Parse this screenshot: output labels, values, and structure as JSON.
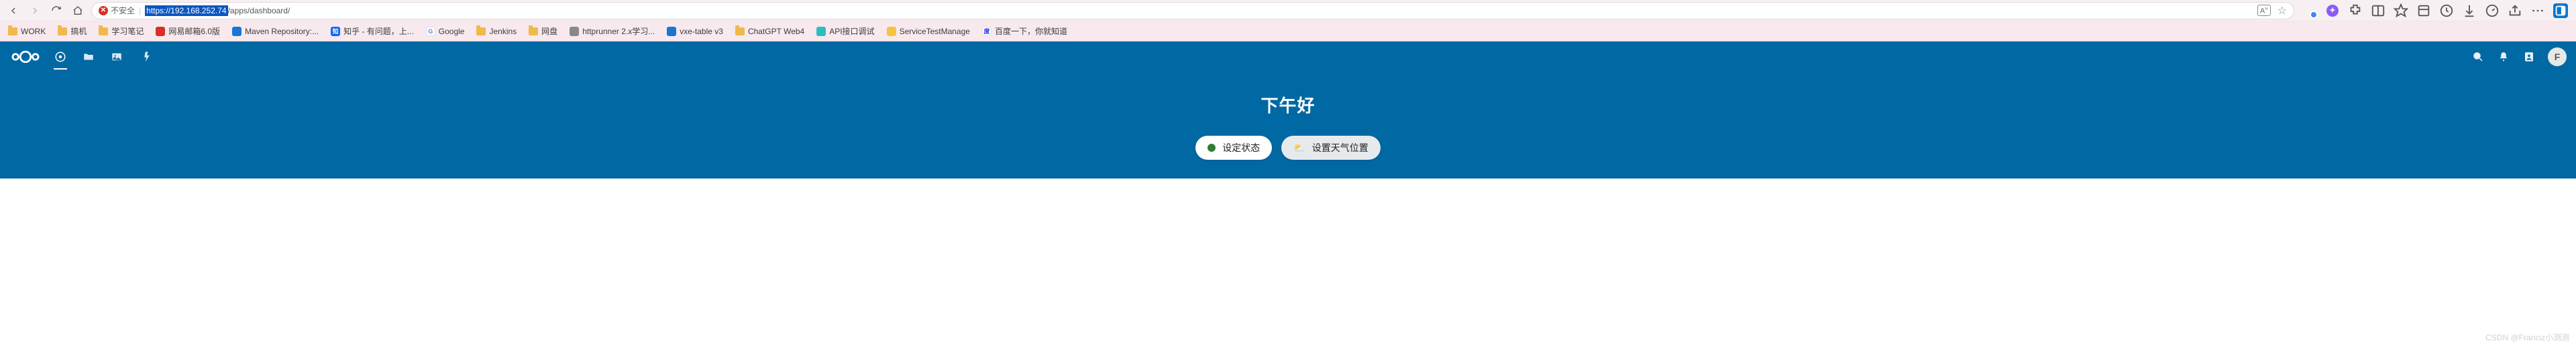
{
  "browser": {
    "insecure_label": "不安全",
    "url_selected": "https://192.168.252.74",
    "url_rest": "/apps/dashboard/",
    "reader": "A"
  },
  "bookmarks": [
    {
      "type": "folder",
      "label": "WORK"
    },
    {
      "type": "folder",
      "label": "搞机"
    },
    {
      "type": "folder",
      "label": "学习笔记"
    },
    {
      "type": "link",
      "icon": "red",
      "label": "网易邮箱6.0版"
    },
    {
      "type": "link",
      "icon": "blue",
      "label": "Maven Repository:..."
    },
    {
      "type": "link",
      "icon": "zh",
      "label": "知乎 - 有问题，上..."
    },
    {
      "type": "link",
      "icon": "google",
      "label": "Google"
    },
    {
      "type": "folder",
      "label": "Jenkins"
    },
    {
      "type": "folder",
      "label": "网盘"
    },
    {
      "type": "link",
      "icon": "gray",
      "label": "httprunner 2.x学习..."
    },
    {
      "type": "link",
      "icon": "blue",
      "label": "vxe-table v3"
    },
    {
      "type": "folder",
      "label": "ChatGPT Web4"
    },
    {
      "type": "link",
      "icon": "teal",
      "label": "API接口调试"
    },
    {
      "type": "link",
      "icon": "yel",
      "label": "ServiceTestManage"
    },
    {
      "type": "link",
      "icon": "baidu",
      "label": "百度一下，你就知道"
    }
  ],
  "app": {
    "greeting": "下午好",
    "status_btn": "设定状态",
    "weather_btn": "设置天气位置",
    "avatar": "F"
  },
  "watermark": "CSDN @Franciz小测测"
}
